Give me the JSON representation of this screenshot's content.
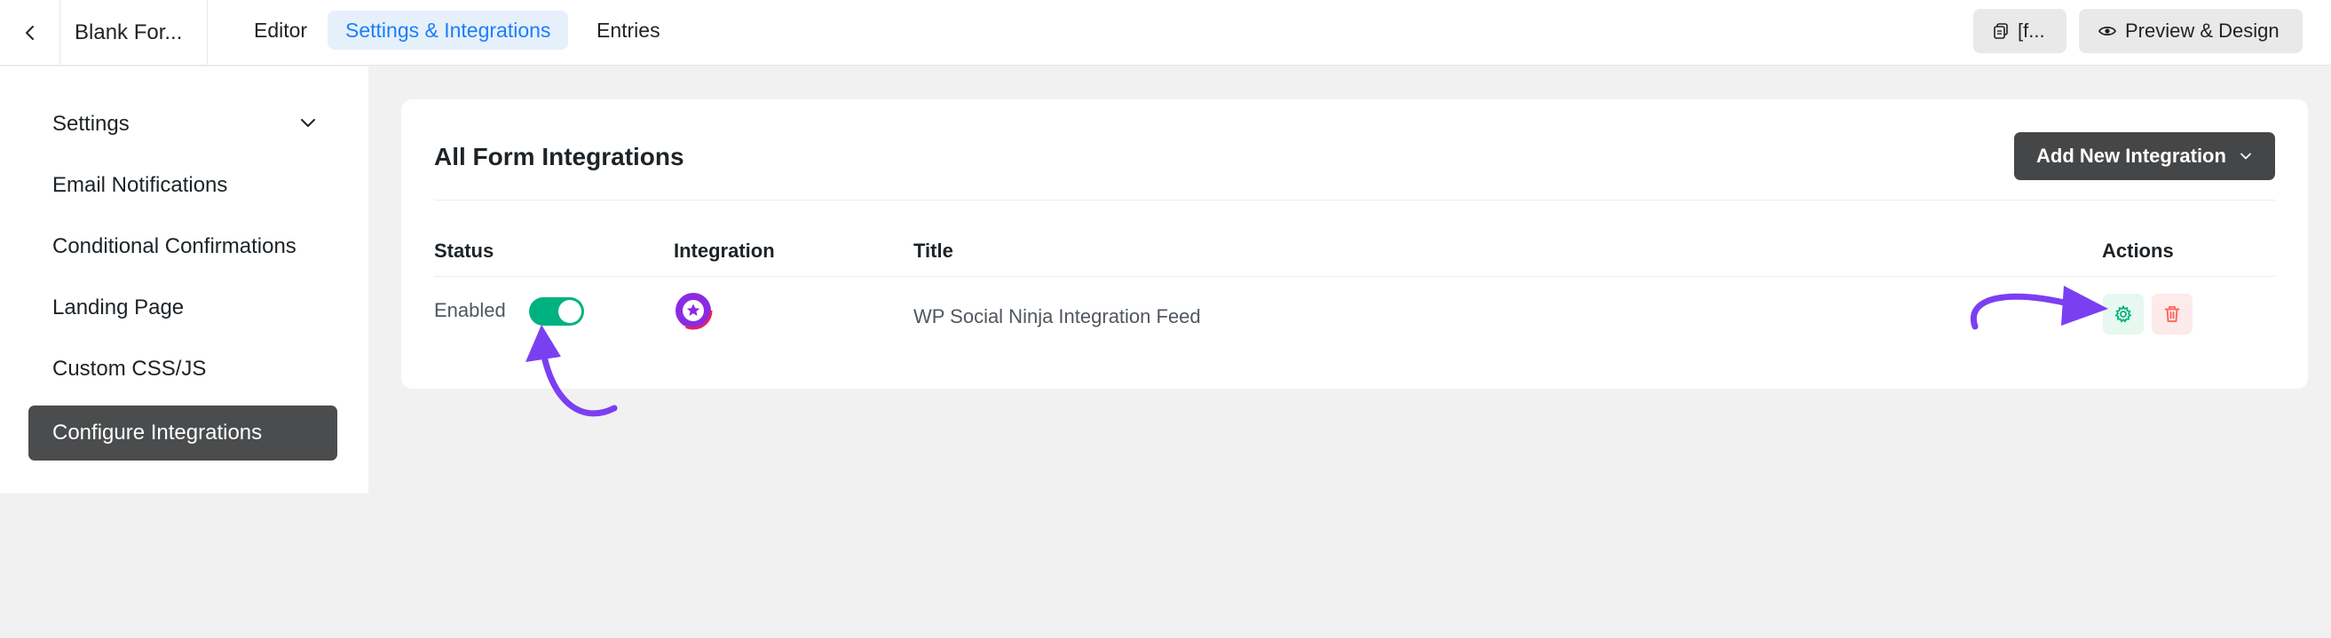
{
  "header": {
    "back_icon": "chevron-left-icon",
    "form_name": "Blank For...",
    "tabs": [
      {
        "label": "Editor",
        "active": false
      },
      {
        "label": "Settings & Integrations",
        "active": true
      },
      {
        "label": "Entries",
        "active": false
      }
    ],
    "shortcode_button": {
      "icon": "copy-icon",
      "label": "[f..."
    },
    "preview_button": {
      "icon": "eye-icon",
      "label": "Preview & Design"
    }
  },
  "sidebar": {
    "items": [
      {
        "label": "Settings",
        "has_chevron": true,
        "active": false
      },
      {
        "label": "Email Notifications",
        "active": false
      },
      {
        "label": "Conditional Confirmations",
        "active": false
      },
      {
        "label": "Landing Page",
        "active": false
      },
      {
        "label": "Custom CSS/JS",
        "active": false
      },
      {
        "label": "Configure Integrations",
        "active": true
      }
    ]
  },
  "main": {
    "title": "All Form Integrations",
    "add_button_label": "Add New Integration",
    "columns": {
      "status": "Status",
      "integration": "Integration",
      "title": "Title",
      "actions": "Actions"
    },
    "rows": [
      {
        "status_text": "Enabled",
        "enabled": true,
        "integration_icon": "wp-social-ninja-icon",
        "title": "WP Social Ninja Integration Feed",
        "actions": [
          "gear-icon",
          "trash-icon"
        ]
      }
    ]
  },
  "colors": {
    "accent": "#1a7efb",
    "toggle_on": "#00b27f",
    "annotation_arrow": "#7b3ff2",
    "active_sidebar": "#4b4c4d",
    "delete": "#ff6154"
  }
}
